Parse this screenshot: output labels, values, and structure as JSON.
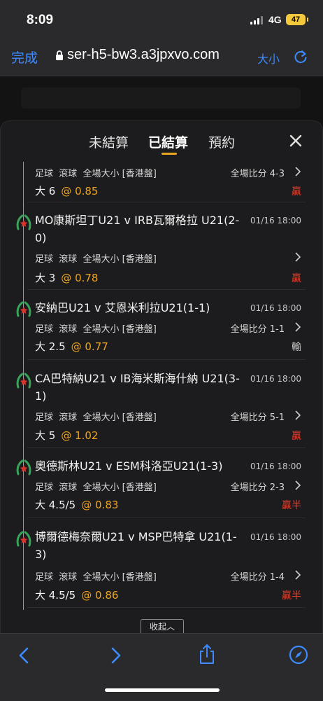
{
  "status": {
    "time": "8:09",
    "network": "4G",
    "battery": "47"
  },
  "browser": {
    "done": "完成",
    "url": "ser-h5-bw3.a3jpxvo.com",
    "text_size": "大小"
  },
  "tabs": [
    {
      "label": "未結算",
      "active": false
    },
    {
      "label": "已結算",
      "active": true
    },
    {
      "label": "預約",
      "active": false
    }
  ],
  "bets": [
    {
      "title": "",
      "date": "",
      "detail": "足球  滾球  全場大小 [香港盤]",
      "score": "全場比分 4-3",
      "pick": "大 6",
      "odds": "@ 0.85",
      "result": "贏",
      "result_color": "#e0402f"
    },
    {
      "title": "MO康斯坦丁U21 v IRB瓦爾格拉 U21(2-0)",
      "date": "01/16 18:00",
      "detail": "足球  滾球  全場大小 [香港盤]",
      "score": "",
      "pick": "大 3",
      "odds": "@ 0.78",
      "result": "贏",
      "result_color": "#e0402f"
    },
    {
      "title": "安納巴U21 v 艾恩米利拉U21(1-1)",
      "date": "01/16 18:00",
      "detail": "足球  滾球  全場大小 [香港盤]",
      "score": "全場比分 1-1",
      "pick": "大 2.5",
      "odds": "@ 0.77",
      "result": "輸",
      "result_color": "#d0d0d0"
    },
    {
      "title": "CA巴特納U21 v IB海米斯海什納 U21(3-1)",
      "date": "01/16 18:00",
      "detail": "足球  滾球  全場大小 [香港盤]",
      "score": "全場比分 5-1",
      "pick": "大 5",
      "odds": "@ 1.02",
      "result": "贏",
      "result_color": "#e0402f"
    },
    {
      "title": "奧德斯林U21 v ESM科洛亞U21(1-3)",
      "date": "01/16 18:00",
      "detail": "足球  滾球  全場大小 [香港盤]",
      "score": "全場比分 2-3",
      "pick": "大 4.5/5",
      "odds": "@ 0.83",
      "result": "贏半",
      "result_color": "#e0402f"
    },
    {
      "title": "博爾德梅奈爾U21 v MSP巴特拿 U21(1-3)",
      "date": "01/16 18:00",
      "detail": "足球  滾球  全場大小 [香港盤]",
      "score": "全場比分 1-4",
      "pick": "大 4.5/5",
      "odds": "@ 0.86",
      "result": "贏半",
      "result_color": "#e0402f"
    }
  ],
  "collapse_label": "收起︿",
  "icons": {
    "team": "soccer-team-icon",
    "close": "close-icon",
    "chevron": "chevron-right-icon"
  }
}
